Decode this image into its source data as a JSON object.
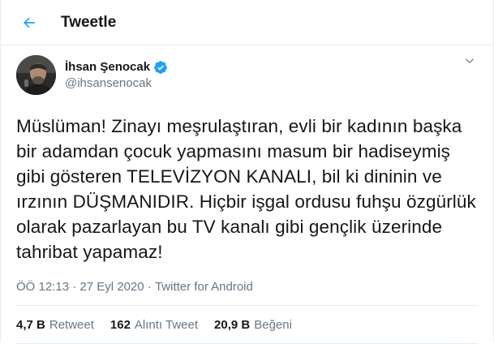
{
  "header": {
    "title": "Tweetle"
  },
  "author": {
    "name": "İhsan Şenocak",
    "handle": "@ihsansenocak"
  },
  "tweet": {
    "text": "Müslüman! Zinayı meşrulaştıran, evli bir kadının başka\nbir adamdan çocuk yapmasını masum bir hadiseymiş\ngibi gösteren TELEVİZYON KANALI, bil ki dininin ve\nırzının DÜŞMANIDIR. Hiçbir işgal ordusu fuhşu özgürlük\nolarak pazarlayan bu TV kanalı gibi gençlik üzerinde\ntahribat yapamaz!",
    "time": "ÖÖ 12:13",
    "separator": "·",
    "date": "27 Eyl 2020",
    "source": "Twitter for Android"
  },
  "stats": [
    {
      "count": "4,7 B",
      "label": "Retweet"
    },
    {
      "count": "162",
      "label": "Alıntı Tweet"
    },
    {
      "count": "20,9 B",
      "label": "Beğeni"
    }
  ],
  "colors": {
    "accent": "#1da1f2",
    "text": "#14171a",
    "muted": "#657786",
    "border": "#e6ecf0"
  },
  "icons": {
    "back": "arrow-left-icon",
    "verified": "verified-badge-icon",
    "more": "chevron-down-icon"
  }
}
